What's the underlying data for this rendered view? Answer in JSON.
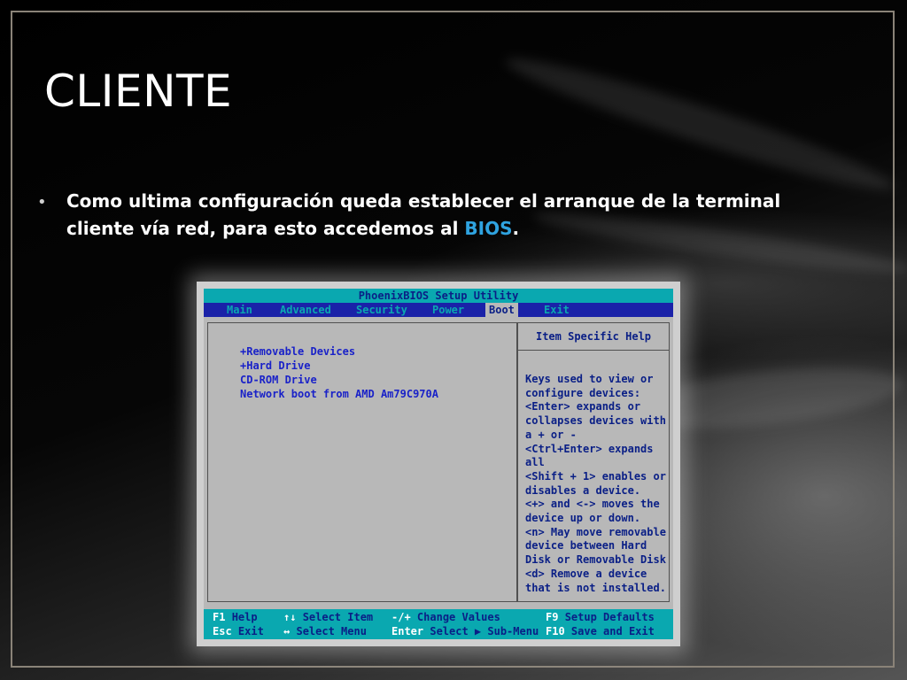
{
  "slide": {
    "title": "CLIENTE",
    "bullet_glyph": "•",
    "bullet_text_1": "Como ultima configuración queda establecer el arranque de la terminal cliente  vía red, para esto accedemos al ",
    "bullet_highlight": "BIOS",
    "bullet_text_2": ".",
    "highlight_color": "#2fa3e0"
  },
  "bios": {
    "title": "PhoenixBIOS Setup Utility",
    "menu": [
      {
        "label": "Main"
      },
      {
        "label": "Advanced"
      },
      {
        "label": "Security"
      },
      {
        "label": "Power"
      },
      {
        "label": "Boot",
        "active": true
      },
      {
        "label": "Exit"
      }
    ],
    "boot_items": [
      {
        "label": "+Removable Devices"
      },
      {
        "label": "+Hard Drive"
      },
      {
        "label": " CD-ROM Drive"
      },
      {
        "label": " Network boot from AMD Am79C970A"
      }
    ],
    "help": {
      "title": "Item Specific Help",
      "lines": [
        "Keys used to view or",
        "configure devices:",
        "<Enter> expands or",
        "collapses devices with",
        "a + or -",
        "<Ctrl+Enter> expands",
        "all",
        "<Shift + 1> enables or",
        "disables a device.",
        "<+> and <-> moves the",
        "device up or down.",
        "<n> May move removable",
        "device between Hard",
        "Disk or Removable Disk",
        "<d> Remove a device",
        "that is not installed."
      ]
    },
    "footer": {
      "row1": [
        {
          "key": "F1",
          "label": "Help"
        },
        {
          "key": "↑↓",
          "label": "Select Item"
        },
        {
          "key": "-/+",
          "label": "Change Values"
        },
        {
          "key": "F9",
          "label": "Setup Defaults"
        }
      ],
      "row2": [
        {
          "key": "Esc",
          "label": "Exit"
        },
        {
          "key": "↔",
          "label": "Select Menu"
        },
        {
          "key": "Enter",
          "label": "Select ▶ Sub-Menu"
        },
        {
          "key": "F10",
          "label": "Save and Exit"
        }
      ]
    }
  }
}
